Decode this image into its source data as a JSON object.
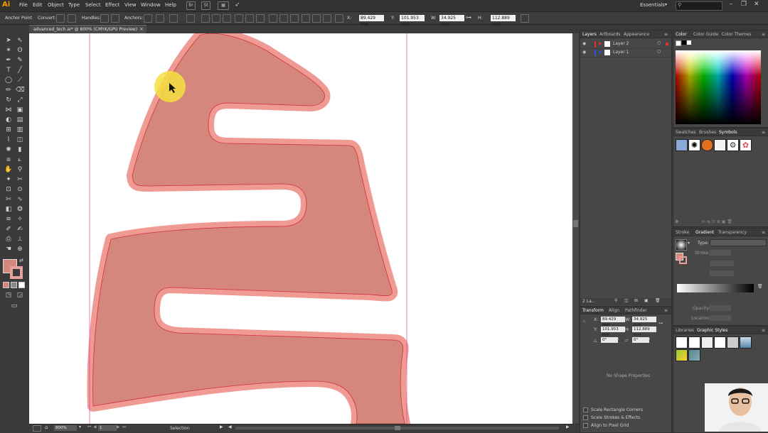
{
  "app": {
    "logo": "Ai"
  },
  "menu": [
    "File",
    "Edit",
    "Object",
    "Type",
    "Select",
    "Effect",
    "View",
    "Window",
    "Help"
  ],
  "menu_buttons": [
    "Br",
    "St"
  ],
  "workspace": "Essentials",
  "search": {
    "placeholder": ""
  },
  "control_bar": {
    "tool_label": "Anchor Point",
    "convert_label": "Convert:",
    "handles_label": "Handles:",
    "anchors_label": "Anchors:",
    "x_label": "X:",
    "x_value": "89.429 mm",
    "y_label": "Y:",
    "y_value": "101.953 mm",
    "w_label": "W:",
    "w_value": "34.925 mm",
    "h_label": "H:",
    "h_value": "112.889 mm"
  },
  "document": {
    "tab_title": "advanced_tech.ai* @ 800% (CMYK/GPU Preview)",
    "close_glyph": "×"
  },
  "status_bar": {
    "zoom": "800%",
    "page": "1",
    "tool": "Selection"
  },
  "layers_panel": {
    "tabs": [
      "Layers",
      "Artboards",
      "Appearance"
    ],
    "layers": [
      {
        "name": "Layer 2",
        "color": "#e03030"
      },
      {
        "name": "Layer 1",
        "color": "#3050e0"
      }
    ],
    "footer": "2 La..."
  },
  "color_panel": {
    "tabs": [
      "Color",
      "Color Guide",
      "Color Themes"
    ]
  },
  "symbols_panel": {
    "tabs": [
      "Swatches",
      "Brushes",
      "Symbols"
    ]
  },
  "gradient_panel": {
    "tabs": [
      "Stroke",
      "Gradient",
      "Transparency"
    ],
    "type_label": "Type:",
    "stroke_label": "Stroke:",
    "opacity_label": "Opacity:",
    "location_label": "Location:"
  },
  "transform_panel": {
    "tabs": [
      "Transform",
      "Align",
      "Pathfinder"
    ],
    "x_label": "X:",
    "x_value": "89.429 mm",
    "y_label": "Y:",
    "y_value": "101.953 mm",
    "w_label": "W:",
    "w_value": "34.925 mm",
    "h_label": "H:",
    "h_value": "112.889 mm",
    "angle_value": "0°",
    "shear_value": "0°",
    "no_shape": "No Shape Properties",
    "options": [
      "Scale Rectangle Corners",
      "Scale Strokes & Effects",
      "Align to Pixel Grid"
    ]
  },
  "libraries_panel": {
    "tabs": [
      "Libraries",
      "Graphic Styles"
    ]
  },
  "colors": {
    "shape_fill": "#d4877a",
    "shape_stroke": "#f09a94",
    "path_line": "#d0303a",
    "guide": "#e040a0",
    "cursor_highlight": "#f5e040"
  }
}
